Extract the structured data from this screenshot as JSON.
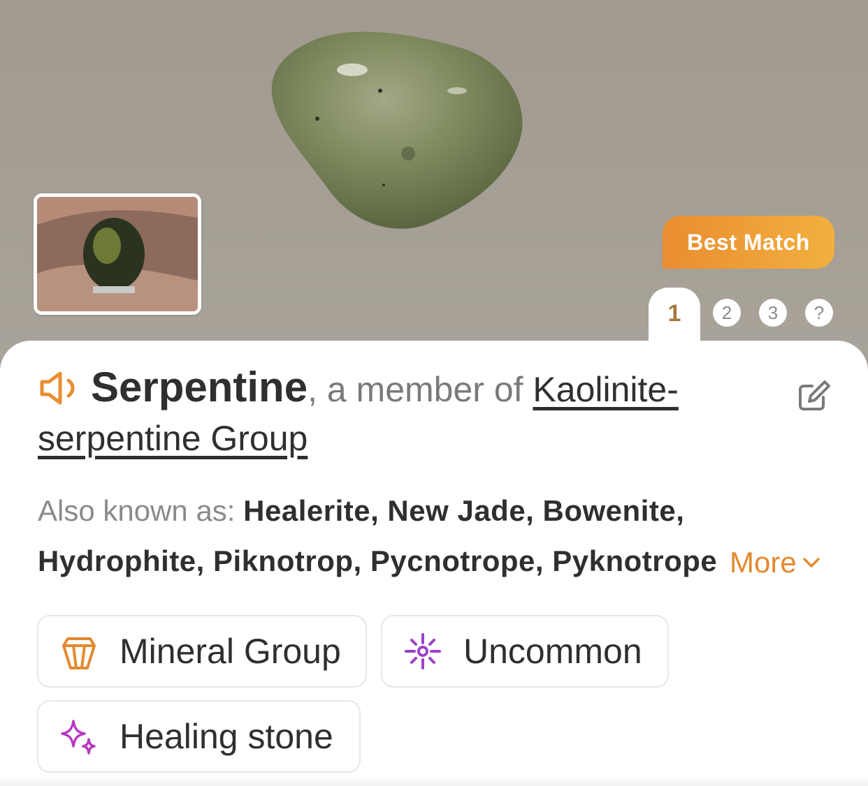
{
  "result": {
    "best_match_label": "Best Match",
    "pager": {
      "active": "1",
      "options": [
        "2",
        "3",
        "?"
      ]
    },
    "name": "Serpentine",
    "member_prefix": ", a member of ",
    "group_name": "Kaolinite-serpentine Group",
    "aka_label": "Also known as: ",
    "aka_line1": "Healerite, New Jade, Bowenite,",
    "aka_line2": "Hydrophite, Piknotrop, Pycnotrope, Pyknotrope",
    "more_label": "More",
    "tags": [
      {
        "label": "Mineral Group",
        "icon": "crystal-icon",
        "color": "#e38a2f"
      },
      {
        "label": "Uncommon",
        "icon": "sparkle-burst-icon",
        "color": "#9b3fc9"
      },
      {
        "label": "Healing stone",
        "icon": "sparkles-icon",
        "color": "#b53ac2"
      }
    ]
  },
  "colors": {
    "accent_orange": "#e98d31",
    "text_dark": "#2f2f2f",
    "text_muted": "#8a8a8a"
  }
}
